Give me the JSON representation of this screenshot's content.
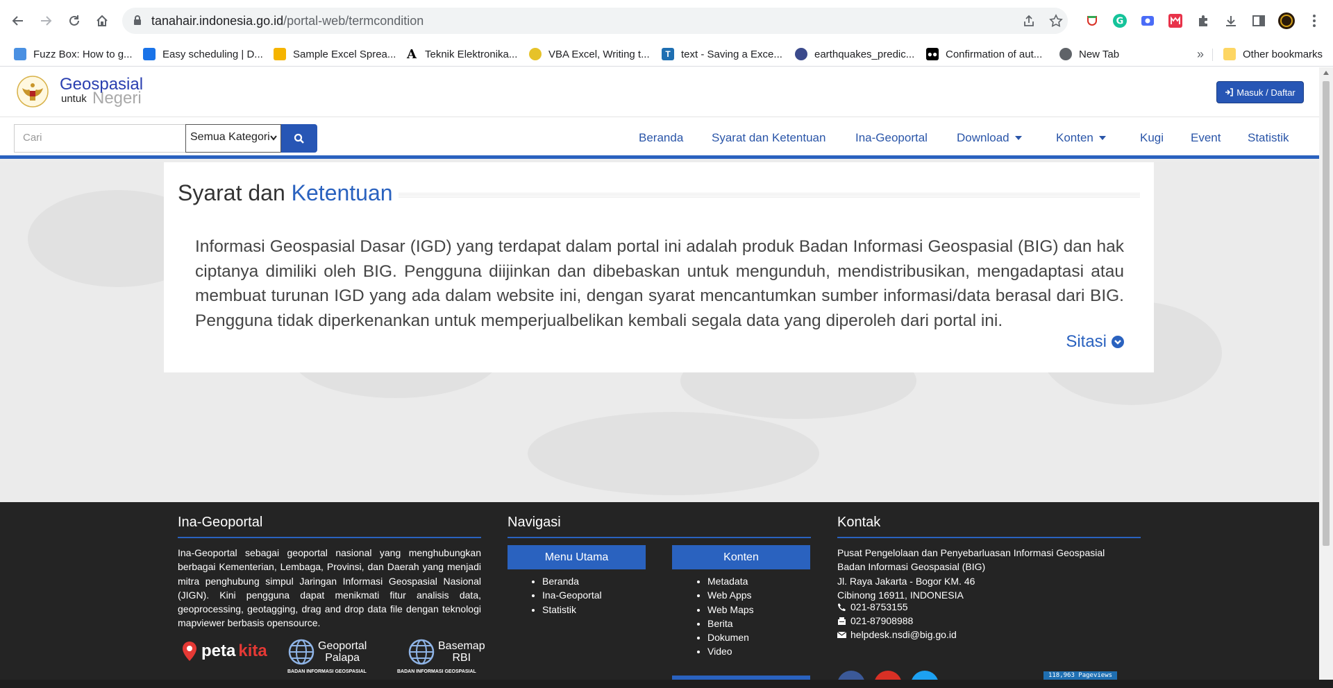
{
  "browser": {
    "url_host": "tanahair.indonesia.go.id",
    "url_path": "/portal-web/termcondition",
    "bookmarks": [
      {
        "label": "Fuzz Box: How to g...",
        "color": "#4a90e2"
      },
      {
        "label": "Easy scheduling | D...",
        "color": "#1a73e8"
      },
      {
        "label": "Sample Excel Sprea...",
        "color": "#f5b400"
      },
      {
        "label": "Teknik Elektronika...",
        "color": "#000000"
      },
      {
        "label": "VBA Excel, Writing t...",
        "color": "#e6c229"
      },
      {
        "label": "text - Saving a Exce...",
        "color": "#1f6fb2"
      },
      {
        "label": "earthquakes_predic...",
        "color": "#3b4a8c"
      },
      {
        "label": "Confirmation of aut...",
        "color": "#000000"
      },
      {
        "label": "New Tab",
        "color": "#5f6368"
      }
    ],
    "overflow": "»",
    "other_bookmarks": "Other bookmarks"
  },
  "site": {
    "brand_top": "Geospasial",
    "brand_small": "untuk",
    "brand_bottom": "Negeri",
    "login": "Masuk / Daftar",
    "search_placeholder": "Cari",
    "category": "Semua Kategori",
    "menu": [
      {
        "label": "Beranda",
        "dropdown": false
      },
      {
        "label": "Syarat dan Ketentuan",
        "dropdown": false
      },
      {
        "label": "Ina-Geoportal",
        "dropdown": false
      },
      {
        "label": "Download",
        "dropdown": true
      },
      {
        "label": "Konten",
        "dropdown": true
      },
      {
        "label": "Kugi",
        "dropdown": false
      },
      {
        "label": "Event",
        "dropdown": false
      },
      {
        "label": "Statistik",
        "dropdown": false
      }
    ],
    "accent_color": "#2a62bf"
  },
  "content": {
    "title_part1": "Syarat dan",
    "title_part2": "Ketentuan",
    "body": "Informasi Geospasial Dasar (IGD) yang terdapat dalam portal ini adalah produk Badan Informasi Geospasial (BIG) dan hak ciptanya dimiliki oleh BIG. Pengguna diijinkan dan dibebaskan untuk mengunduh, mendistribusikan, mengadaptasi atau membuat turunan IGD yang ada dalam website ini, dengan syarat mencantumkan sumber informasi/data berasal dari BIG. Pengguna tidak diperkenankan untuk memperjualbelikan kembali segala data yang diperoleh dari portal ini.",
    "sitasi": "Sitasi"
  },
  "footer": {
    "about_title": "Ina-Geoportal",
    "about_text": "Ina-Geoportal sebagai geoportal nasional yang menghubungkan berbagai Kementerian, Lembaga, Provinsi, dan Daerah yang menjadi mitra penghubung simpul Jaringan Informasi Geospasial Nasional (JIGN). Kini pengguna dapat menikmati fitur analisis data, geoprocessing, geotagging, drag and drop data file dengan teknologi mapviewer berbasis opensource.",
    "nav_title": "Navigasi",
    "menu_utama_label": "Menu Utama",
    "menu_utama": [
      "Beranda",
      "Ina-Geoportal",
      "Statistik"
    ],
    "konten_label": "Konten",
    "konten": [
      "Metadata",
      "Web Apps",
      "Web Maps",
      "Berita",
      "Dokumen",
      "Video"
    ],
    "contact_title": "Kontak",
    "contact_lines": [
      "Pusat Pengelolaan dan Penyebarluasan Informasi Geospasial",
      "Badan Informasi Geospasial (BIG)",
      "Jl. Raya Jakarta - Bogor KM. 46",
      "Cibinong 16911, INDONESIA"
    ],
    "phone": "021-8753155",
    "fax": "021-87908988",
    "email": "helpdesk.nsdi@big.go.id",
    "pageviews": "118,963 Pageviews",
    "partners": {
      "petakita_1": "peta",
      "petakita_2": "kita",
      "geoportal_1": "Geoportal",
      "geoportal_2": "Palapa",
      "basemap_1": "Basemap",
      "basemap_2": "RBI",
      "agency": "BADAN INFORMASI GEOSPASIAL"
    }
  }
}
